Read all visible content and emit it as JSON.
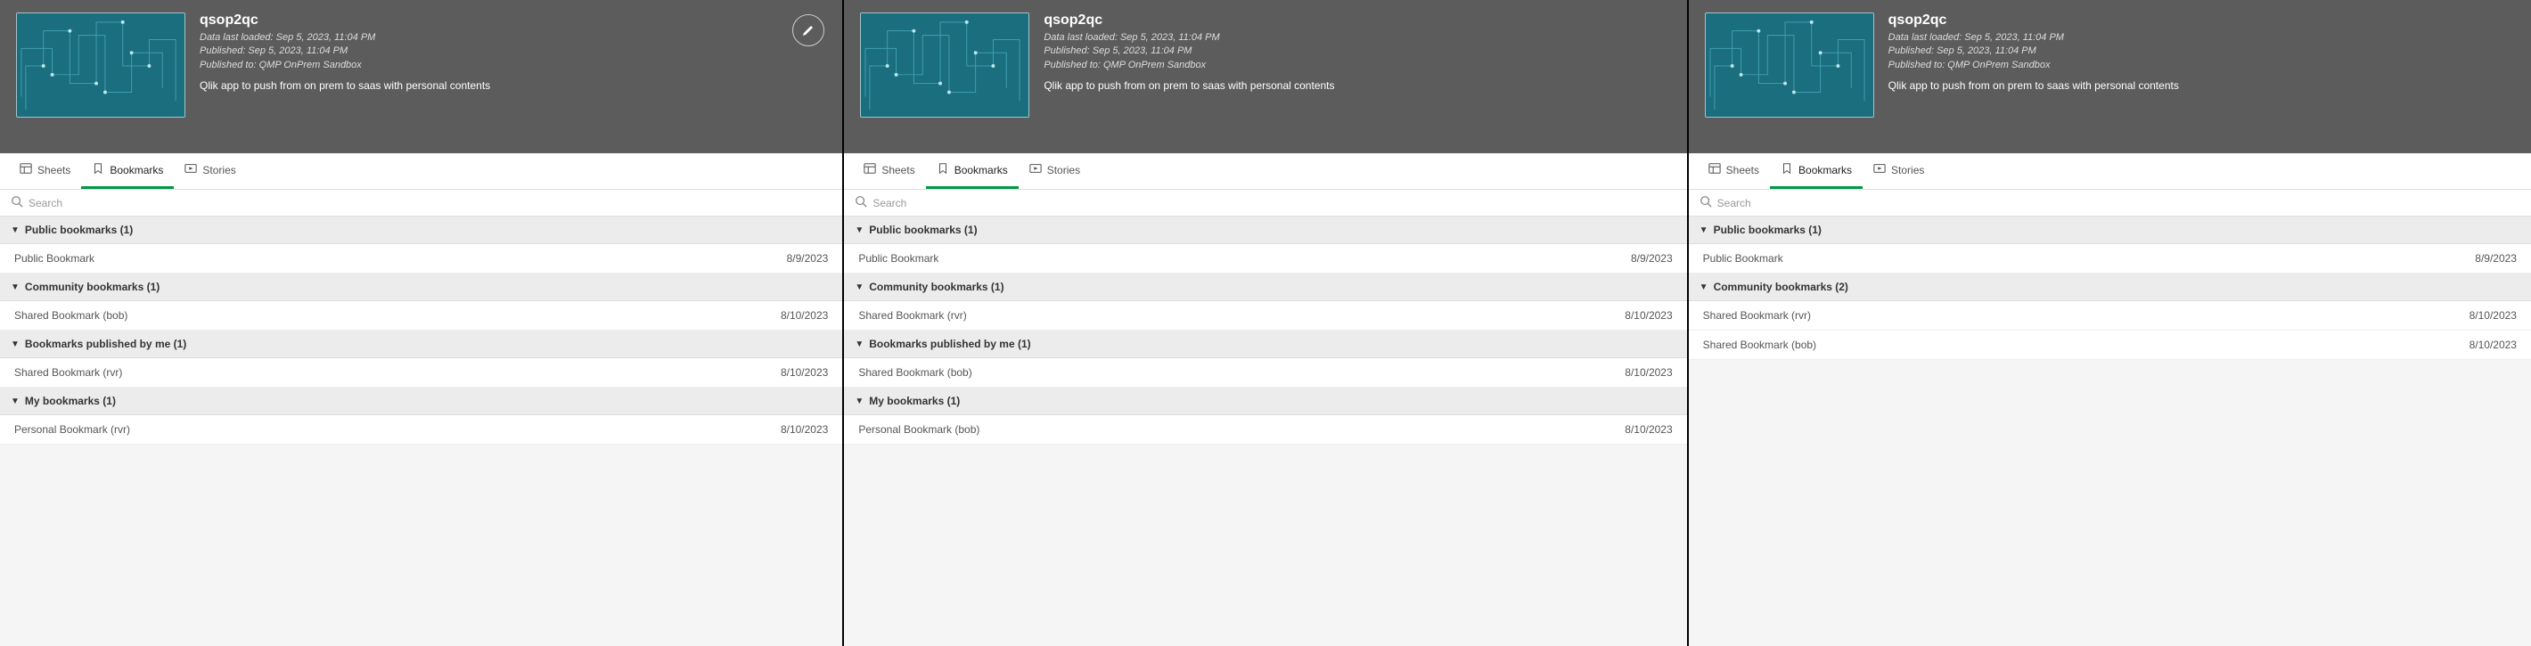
{
  "panels": [
    {
      "app": {
        "title": "qsop2qc",
        "meta1": "Data last loaded: Sep 5, 2023, 11:04 PM",
        "meta2": "Published: Sep 5, 2023, 11:04 PM",
        "meta3": "Published to: QMP OnPrem Sandbox",
        "desc": "Qlik app to push from on prem to saas with personal contents",
        "showEdit": true
      },
      "tabs": {
        "sheets": "Sheets",
        "bookmarks": "Bookmarks",
        "stories": "Stories"
      },
      "search": {
        "placeholder": "Search"
      },
      "groups": [
        {
          "label": "Public bookmarks (1)",
          "rows": [
            {
              "name": "Public Bookmark",
              "date": "8/9/2023"
            }
          ]
        },
        {
          "label": "Community bookmarks (1)",
          "rows": [
            {
              "name": "Shared Bookmark (bob)",
              "date": "8/10/2023"
            }
          ]
        },
        {
          "label": "Bookmarks published by me (1)",
          "rows": [
            {
              "name": "Shared Bookmark (rvr)",
              "date": "8/10/2023"
            }
          ]
        },
        {
          "label": "My bookmarks (1)",
          "rows": [
            {
              "name": "Personal Bookmark (rvr)",
              "date": "8/10/2023"
            }
          ]
        }
      ]
    },
    {
      "app": {
        "title": "qsop2qc",
        "meta1": "Data last loaded: Sep 5, 2023, 11:04 PM",
        "meta2": "Published: Sep 5, 2023, 11:04 PM",
        "meta3": "Published to: QMP OnPrem Sandbox",
        "desc": "Qlik app to push from on prem to saas with personal contents",
        "showEdit": false
      },
      "tabs": {
        "sheets": "Sheets",
        "bookmarks": "Bookmarks",
        "stories": "Stories"
      },
      "search": {
        "placeholder": "Search"
      },
      "groups": [
        {
          "label": "Public bookmarks (1)",
          "rows": [
            {
              "name": "Public Bookmark",
              "date": "8/9/2023"
            }
          ]
        },
        {
          "label": "Community bookmarks (1)",
          "rows": [
            {
              "name": "Shared Bookmark (rvr)",
              "date": "8/10/2023"
            }
          ]
        },
        {
          "label": "Bookmarks published by me (1)",
          "rows": [
            {
              "name": "Shared Bookmark (bob)",
              "date": "8/10/2023"
            }
          ]
        },
        {
          "label": "My bookmarks (1)",
          "rows": [
            {
              "name": "Personal Bookmark (bob)",
              "date": "8/10/2023"
            }
          ]
        }
      ]
    },
    {
      "app": {
        "title": "qsop2qc",
        "meta1": "Data last loaded: Sep 5, 2023, 11:04 PM",
        "meta2": "Published: Sep 5, 2023, 11:04 PM",
        "meta3": "Published to: QMP OnPrem Sandbox",
        "desc": "Qlik app to push from on prem to saas with personal contents",
        "showEdit": false
      },
      "tabs": {
        "sheets": "Sheets",
        "bookmarks": "Bookmarks",
        "stories": "Stories"
      },
      "search": {
        "placeholder": "Search"
      },
      "groups": [
        {
          "label": "Public bookmarks (1)",
          "rows": [
            {
              "name": "Public Bookmark",
              "date": "8/9/2023"
            }
          ]
        },
        {
          "label": "Community bookmarks (2)",
          "rows": [
            {
              "name": "Shared Bookmark (rvr)",
              "date": "8/10/2023"
            },
            {
              "name": "Shared Bookmark (bob)",
              "date": "8/10/2023"
            }
          ]
        }
      ]
    }
  ]
}
